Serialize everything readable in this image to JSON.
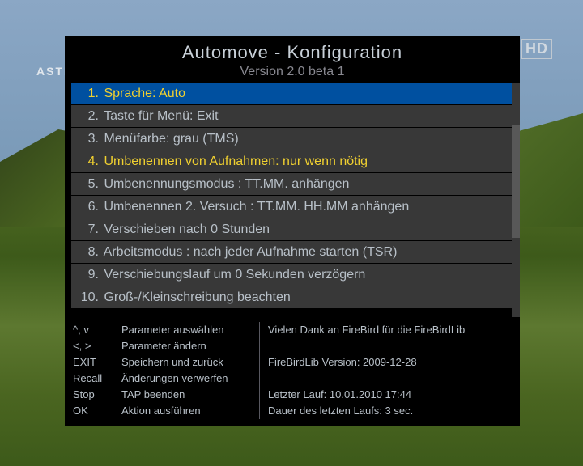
{
  "logo": "ASTI",
  "hd_badge": "HD",
  "header": {
    "title": "Automove - Konfiguration",
    "version": "Version 2.0 beta 1"
  },
  "menu": {
    "items": [
      {
        "num": "1.",
        "label": "Sprache: Auto",
        "selected": true,
        "highlighted": false
      },
      {
        "num": "2.",
        "label": "Taste für Menü: Exit",
        "selected": false,
        "highlighted": false
      },
      {
        "num": "3.",
        "label": "Menüfarbe: grau (TMS)",
        "selected": false,
        "highlighted": false
      },
      {
        "num": "4.",
        "label": "Umbenennen von Aufnahmen: nur wenn nötig",
        "selected": false,
        "highlighted": true
      },
      {
        "num": "5.",
        "label": "  Umbenennungsmodus : TT.MM. anhängen",
        "selected": false,
        "highlighted": false
      },
      {
        "num": "6.",
        "label": "  Umbenennen 2. Versuch : TT.MM. HH.MM anhängen",
        "selected": false,
        "highlighted": false
      },
      {
        "num": "7.",
        "label": "Verschieben nach 0 Stunden",
        "selected": false,
        "highlighted": false
      },
      {
        "num": "8.",
        "label": "Arbeitsmodus : nach jeder Aufnahme starten (TSR)",
        "selected": false,
        "highlighted": false
      },
      {
        "num": "9.",
        "label": "Verschiebungslauf um 0 Sekunden verzögern",
        "selected": false,
        "highlighted": false
      },
      {
        "num": "10.",
        "label": "Groß-/Kleinschreibung beachten",
        "selected": false,
        "highlighted": false
      }
    ]
  },
  "footer": {
    "left": [
      {
        "key": "^, v",
        "desc": "Parameter auswählen"
      },
      {
        "key": "<, >",
        "desc": "Parameter ändern"
      },
      {
        "key": "EXIT",
        "desc": "Speichern und zurück"
      },
      {
        "key": "Recall",
        "desc": "Änderungen verwerfen"
      },
      {
        "key": "Stop",
        "desc": "TAP beenden"
      },
      {
        "key": "OK",
        "desc": "Aktion ausführen"
      }
    ],
    "right": [
      "Vielen Dank an FireBird für die FireBirdLib",
      "",
      "FireBirdLib Version: 2009-12-28",
      "",
      "Letzter Lauf: 10.01.2010 17:44",
      "Dauer des letzten Laufs: 3 sec."
    ]
  }
}
